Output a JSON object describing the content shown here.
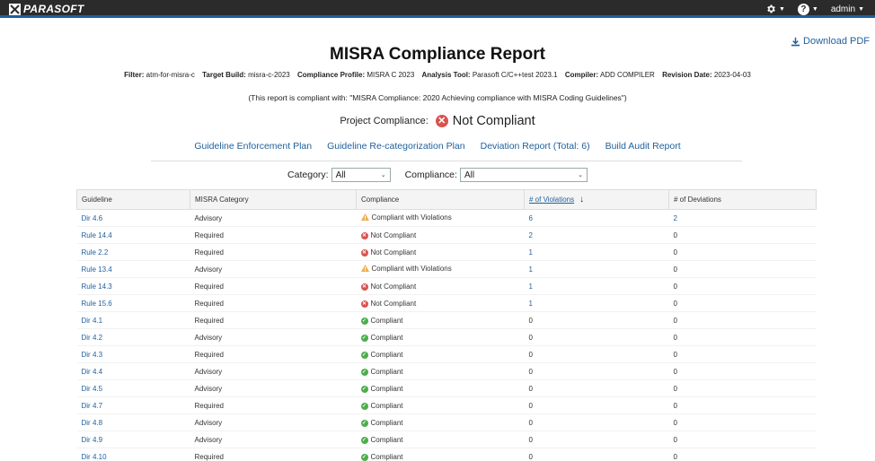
{
  "header": {
    "logo_text": "PARASOFT",
    "user": "admin",
    "icons": {
      "settings": "gear-icon",
      "help": "question-icon"
    }
  },
  "download_label": "Download PDF",
  "title": "MISRA Compliance Report",
  "meta": [
    {
      "label": "Filter:",
      "value": "atm-for-misra-c"
    },
    {
      "label": "Target Build:",
      "value": "misra-c-2023"
    },
    {
      "label": "Compliance Profile:",
      "value": "MISRA C 2023"
    },
    {
      "label": "Analysis Tool:",
      "value": "Parasoft C/C++test 2023.1"
    },
    {
      "label": "Compiler:",
      "value": "ADD COMPILER"
    },
    {
      "label": "Revision Date:",
      "value": "2023-04-03"
    }
  ],
  "compliant_with": "(This report is compliant with: \"MISRA Compliance: 2020 Achieving compliance with MISRA Coding Guidelines\")",
  "project_compliance": {
    "label": "Project Compliance:",
    "status": "Not Compliant"
  },
  "links": [
    "Guideline Enforcement Plan",
    "Guideline Re-categorization Plan",
    "Deviation Report (Total: 6)",
    "Build Audit Report"
  ],
  "filters": {
    "category": {
      "label": "Category:",
      "value": "All"
    },
    "compliance": {
      "label": "Compliance:",
      "value": "All"
    }
  },
  "table": {
    "columns": [
      "Guideline",
      "MISRA Category",
      "Compliance",
      "# of Violations",
      "# of Deviations"
    ],
    "rows": [
      {
        "guideline": "Dir 4.6",
        "category": "Advisory",
        "compliance": "Compliant with Violations",
        "status": "warn",
        "violations": "6",
        "deviations": "2",
        "v_link": true,
        "d_link": true
      },
      {
        "guideline": "Rule 14.4",
        "category": "Required",
        "compliance": "Not Compliant",
        "status": "nc",
        "violations": "2",
        "deviations": "0",
        "v_link": true,
        "d_link": false
      },
      {
        "guideline": "Rule 2.2",
        "category": "Required",
        "compliance": "Not Compliant",
        "status": "nc",
        "violations": "1",
        "deviations": "0",
        "v_link": true,
        "d_link": false
      },
      {
        "guideline": "Rule 13.4",
        "category": "Advisory",
        "compliance": "Compliant with Violations",
        "status": "warn",
        "violations": "1",
        "deviations": "0",
        "v_link": true,
        "d_link": false
      },
      {
        "guideline": "Rule 14.3",
        "category": "Required",
        "compliance": "Not Compliant",
        "status": "nc",
        "violations": "1",
        "deviations": "0",
        "v_link": true,
        "d_link": false
      },
      {
        "guideline": "Rule 15.6",
        "category": "Required",
        "compliance": "Not Compliant",
        "status": "nc",
        "violations": "1",
        "deviations": "0",
        "v_link": true,
        "d_link": false
      },
      {
        "guideline": "Dir 4.1",
        "category": "Required",
        "compliance": "Compliant",
        "status": "ok",
        "violations": "0",
        "deviations": "0",
        "v_link": false,
        "d_link": false
      },
      {
        "guideline": "Dir 4.2",
        "category": "Advisory",
        "compliance": "Compliant",
        "status": "ok",
        "violations": "0",
        "deviations": "0",
        "v_link": false,
        "d_link": false
      },
      {
        "guideline": "Dir 4.3",
        "category": "Required",
        "compliance": "Compliant",
        "status": "ok",
        "violations": "0",
        "deviations": "0",
        "v_link": false,
        "d_link": false
      },
      {
        "guideline": "Dir 4.4",
        "category": "Advisory",
        "compliance": "Compliant",
        "status": "ok",
        "violations": "0",
        "deviations": "0",
        "v_link": false,
        "d_link": false
      },
      {
        "guideline": "Dir 4.5",
        "category": "Advisory",
        "compliance": "Compliant",
        "status": "ok",
        "violations": "0",
        "deviations": "0",
        "v_link": false,
        "d_link": false
      },
      {
        "guideline": "Dir 4.7",
        "category": "Required",
        "compliance": "Compliant",
        "status": "ok",
        "violations": "0",
        "deviations": "0",
        "v_link": false,
        "d_link": false
      },
      {
        "guideline": "Dir 4.8",
        "category": "Advisory",
        "compliance": "Compliant",
        "status": "ok",
        "violations": "0",
        "deviations": "0",
        "v_link": false,
        "d_link": false
      },
      {
        "guideline": "Dir 4.9",
        "category": "Advisory",
        "compliance": "Compliant",
        "status": "ok",
        "violations": "0",
        "deviations": "0",
        "v_link": false,
        "d_link": false
      },
      {
        "guideline": "Dir 4.10",
        "category": "Required",
        "compliance": "Compliant",
        "status": "ok",
        "violations": "0",
        "deviations": "0",
        "v_link": false,
        "d_link": false
      }
    ]
  },
  "colors": {
    "link": "#1f5f9c",
    "not_compliant": "#d9534f",
    "compliant": "#4cae4c",
    "warning": "#f0ad4e",
    "topbar": "#2b2b2b"
  }
}
